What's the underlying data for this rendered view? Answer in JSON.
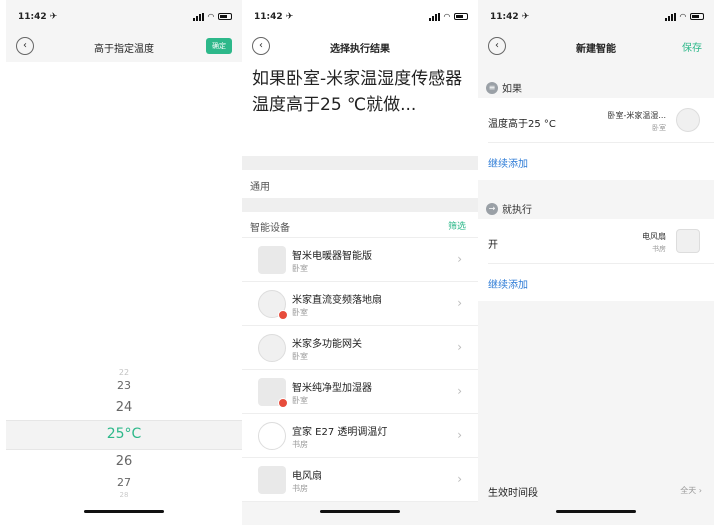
{
  "status": {
    "time": "11:42 ✈"
  },
  "screen1": {
    "title": "高于指定温度",
    "confirm": "确定",
    "picker": {
      "items": [
        "22",
        "23",
        "24",
        "25°C",
        "26",
        "27",
        "28"
      ],
      "selected_index": 3,
      "accent": "#2db88a"
    }
  },
  "screen2": {
    "title": "选择执行结果",
    "headline": "如果卧室-米家温湿度传感器温度高于25 ℃就做...",
    "general_label": "通用",
    "smart_devices_label": "智能设备",
    "filter_label": "筛选",
    "devices": [
      {
        "name": "智米电暖器智能版",
        "room": "卧室",
        "icon": "heater-icon"
      },
      {
        "name": "米家直流变频落地扇",
        "room": "卧室",
        "icon": "fan-icon"
      },
      {
        "name": "米家多功能网关",
        "room": "卧室",
        "icon": "gateway-icon"
      },
      {
        "name": "智米纯净型加湿器",
        "room": "卧室",
        "icon": "humidifier-icon"
      },
      {
        "name": "宜家 E27 透明调温灯",
        "room": "书房",
        "icon": "bulb-icon"
      },
      {
        "name": "电风扇",
        "room": "书房",
        "icon": "plug-icon"
      }
    ]
  },
  "screen3": {
    "title": "新建智能",
    "save": "保存",
    "if_label": "如果",
    "condition": {
      "label": "温度高于25 °C",
      "device": "卧室-米家温湿...",
      "room": "卧室"
    },
    "add_more_1": "继续添加",
    "then_label": "就执行",
    "action": {
      "label": "开",
      "device": "电风扇",
      "room": "书房"
    },
    "add_more_2": "继续添加",
    "effective_time_label": "生效时间段",
    "effective_time_value": "全天 ›"
  },
  "colors": {
    "accent": "#2db88a",
    "link": "#2d7bd6"
  }
}
